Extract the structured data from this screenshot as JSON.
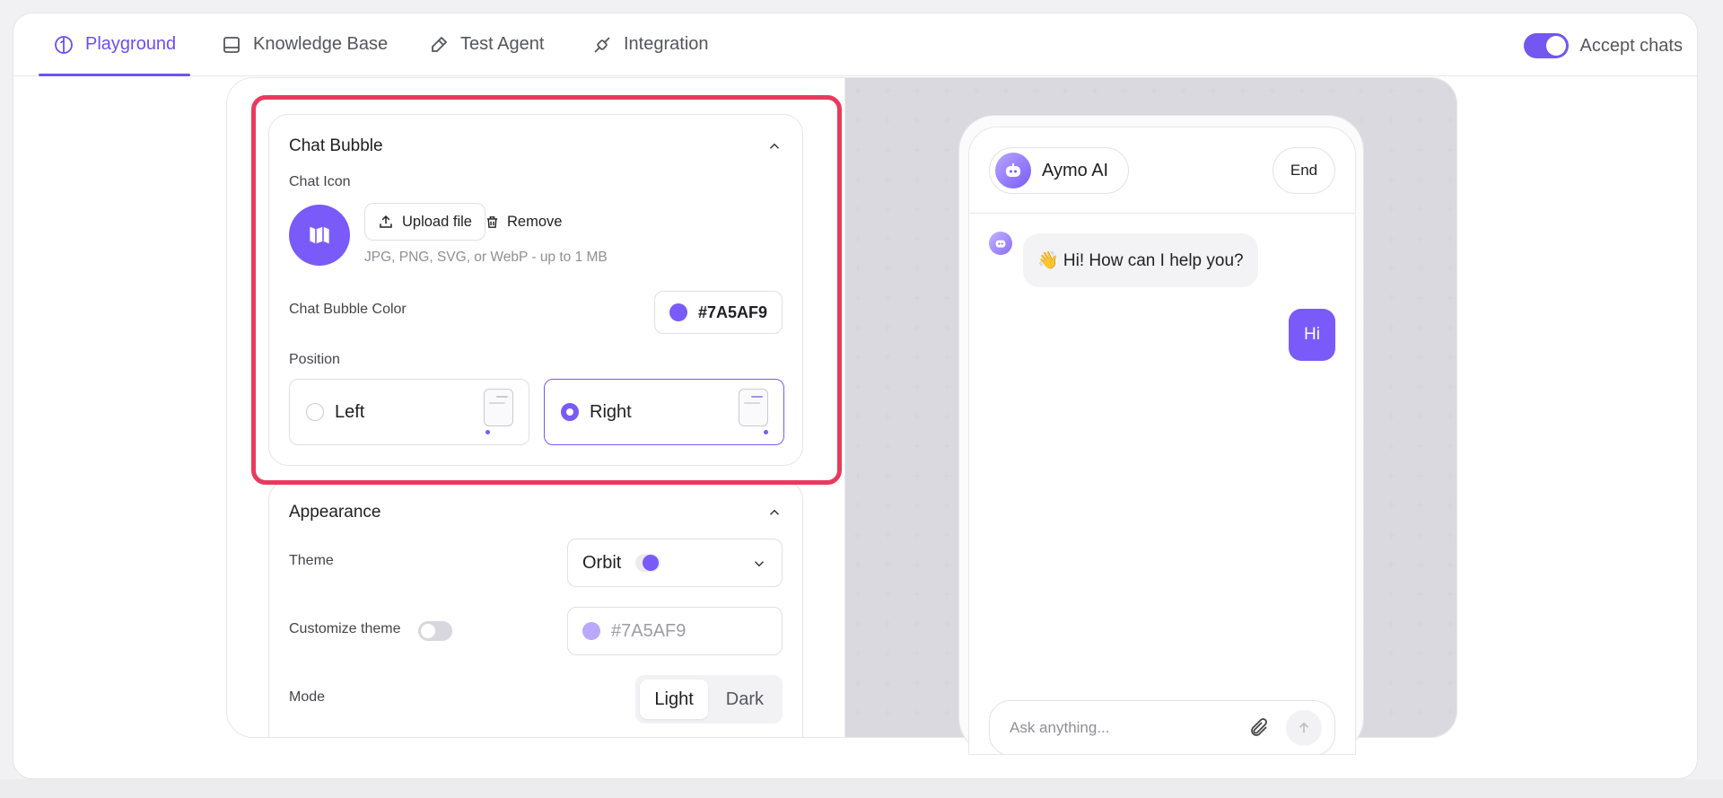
{
  "nav": {
    "tabs": [
      {
        "label": "Playground",
        "icon": "brain-icon",
        "active": true
      },
      {
        "label": "Knowledge Base",
        "icon": "book-icon",
        "active": false
      },
      {
        "label": "Test Agent",
        "icon": "eraser-icon",
        "active": false
      },
      {
        "label": "Integration",
        "icon": "plug-icon",
        "active": false
      }
    ],
    "accept_chats_label": "Accept chats",
    "accept_chats_on": true
  },
  "chat_bubble": {
    "title": "Chat Bubble",
    "chat_icon_label": "Chat Icon",
    "upload_label": "Upload file",
    "remove_label": "Remove",
    "upload_hint": "JPG, PNG, SVG, or WebP - up to 1 MB",
    "color_label": "Chat Bubble Color",
    "color_value": "#7A5AF9",
    "position_label": "Position",
    "position_left": "Left",
    "position_right": "Right",
    "selected_position": "Right"
  },
  "appearance": {
    "title": "Appearance",
    "theme_label": "Theme",
    "theme_value": "Orbit",
    "customize_label": "Customize theme",
    "customize_on": false,
    "customize_color": "#7A5AF9",
    "mode_label": "Mode",
    "mode_light": "Light",
    "mode_dark": "Dark",
    "mode_selected": "Light"
  },
  "preview": {
    "agent_name": "Aymo AI",
    "end_label": "End",
    "bot_message": "👋 Hi! How can I help you?",
    "user_message": "Hi",
    "composer_placeholder": "Ask anything..."
  },
  "colors": {
    "accent": "#7A5AF9",
    "highlight": "#E93A5E"
  }
}
